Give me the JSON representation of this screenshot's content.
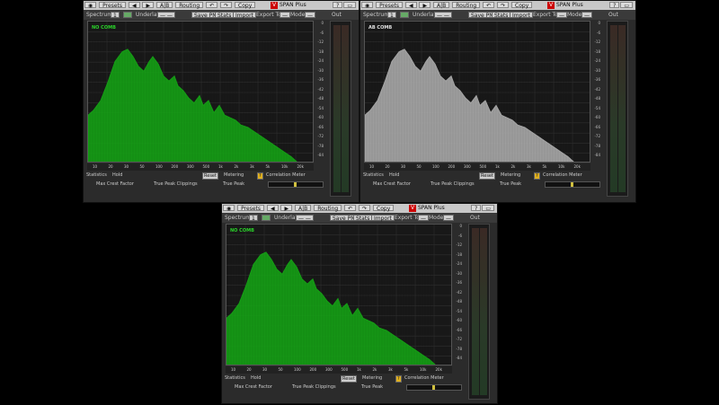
{
  "labels": {
    "presets": "Presets",
    "routing": "Routing",
    "copy": "Copy",
    "app_title": "SPAN Plus",
    "spectrum": "Spectrum",
    "underlay": "Underlay",
    "save_png": "Save PNG",
    "stats_menu": "Stats",
    "import": "Import",
    "export_to": "Export To",
    "mode": "Mode",
    "out": "Out",
    "statistics": "Statistics",
    "hold": "Hold",
    "reset": "Reset",
    "metering": "Metering",
    "correlation_meter": "Correlation Meter",
    "max_crest_factor": "Max Crest Factor",
    "true_peak_clippings": "True Peak Clippings",
    "true_peak": "True Peak"
  },
  "windows": [
    {
      "id": "w1",
      "plot_label": "NO COMB",
      "spectrum_color": "#16a016",
      "label_color": "#2ad42a"
    },
    {
      "id": "w2",
      "plot_label": "AB COMB",
      "spectrum_color": "#a8a8a8",
      "label_color": "#e0e0e0"
    },
    {
      "id": "w3",
      "plot_label": "NO COMB",
      "spectrum_color": "#16a016",
      "label_color": "#2ad42a"
    }
  ],
  "freq_ticks": [
    "10",
    "20",
    "30",
    "50",
    "100",
    "200",
    "300",
    "500",
    "1k",
    "2k",
    "3k",
    "5k",
    "10k",
    "20k"
  ],
  "db_ticks": [
    "0",
    "-6",
    "-12",
    "-18",
    "-24",
    "-30",
    "-36",
    "-42",
    "-48",
    "-54",
    "-60",
    "-66",
    "-72",
    "-78",
    "-84"
  ]
}
